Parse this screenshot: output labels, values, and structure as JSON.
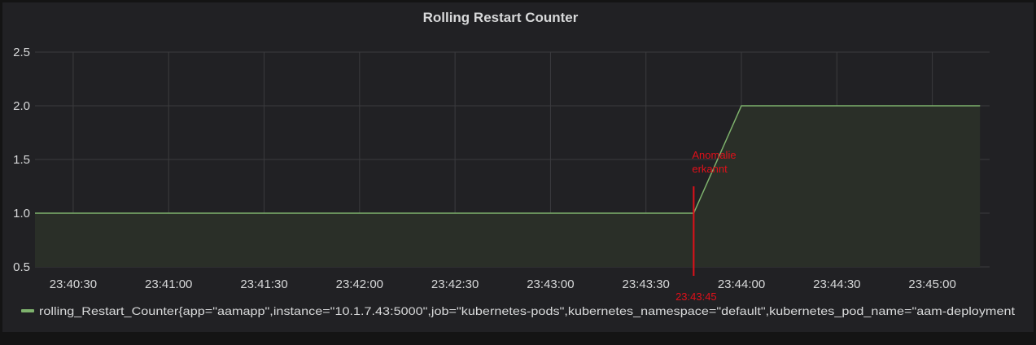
{
  "colors": {
    "series": "#7eb26d",
    "fill": "#2a2f28",
    "grid": "#3b3b3e",
    "text": "#d8d9da",
    "annotation": "#e0101a"
  },
  "chart_data": {
    "type": "area",
    "title": "Rolling Restart Counter",
    "xlabel": "",
    "ylabel": "",
    "x_ticks": [
      "23:40:30",
      "23:41:00",
      "23:41:30",
      "23:42:00",
      "23:42:30",
      "23:43:00",
      "23:43:30",
      "23:44:00",
      "23:44:30",
      "23:45:00"
    ],
    "y_ticks": [
      "0.5",
      "1.0",
      "1.5",
      "2.0",
      "2.5"
    ],
    "xlim": [
      "23:40:18",
      "23:45:18"
    ],
    "ylim": [
      0.5,
      2.5
    ],
    "grid": true,
    "legend_position": "bottom-left",
    "series": [
      {
        "name": "rolling_Restart_Counter{app=\"aamapp\",instance=\"10.1.7.43:5000\",job=\"kubernetes-pods\",kubernetes_namespace=\"default\",kubernetes_pod_name=\"aam-deployment",
        "x": [
          "23:40:18",
          "23:43:45",
          "23:44:00",
          "23:45:15"
        ],
        "y": [
          1,
          1,
          2,
          2
        ]
      }
    ],
    "annotations": [
      {
        "x": "23:43:45",
        "label_lines": [
          "Anomalie",
          "erkannt"
        ],
        "time_label": "23:43:45"
      }
    ]
  }
}
